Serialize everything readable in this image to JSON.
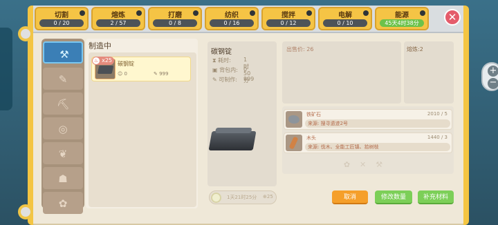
{
  "tabs": [
    {
      "label": "切割",
      "progress": "0 / 20"
    },
    {
      "label": "熔炼",
      "progress": "2 / 57"
    },
    {
      "label": "打磨",
      "progress": "0 / 8"
    },
    {
      "label": "纺织",
      "progress": "0 / 16"
    },
    {
      "label": "搅拌",
      "progress": "0 / 12"
    },
    {
      "label": "电解",
      "progress": "0 / 10"
    },
    {
      "label": "能源",
      "progress": "45天4时38分"
    }
  ],
  "close_symbol": "✕",
  "list": {
    "title": "制造中",
    "item": {
      "name": "碳钢锭",
      "badge": "x25",
      "meta_left": "0",
      "meta_right": "999"
    }
  },
  "detail": {
    "title": "碳钢锭",
    "rows": [
      {
        "label": "耗时:",
        "value": "1时50分"
      },
      {
        "label": "背包内:",
        "value": "0"
      },
      {
        "label": "可制作:",
        "value": "999"
      }
    ]
  },
  "sell": {
    "text": "出售价: 26"
  },
  "melt": {
    "text": "熔炼:2"
  },
  "materials": [
    {
      "name": "铁矿石",
      "count": "2010 / 5",
      "source": "来源: 搜寻遗迹2号",
      "icon": "rock-icon"
    },
    {
      "name": "木头",
      "count": "1440 / 3",
      "source": "来源: 伐木、全能工匠镇、拾树枝",
      "icon": "wood-icon"
    }
  ],
  "time": {
    "text": "1天21时25分",
    "queue": "25"
  },
  "buttons": {
    "cancel": "取消",
    "modify": "修改数量",
    "refill": "补充材料"
  },
  "colors": {
    "accent": "#f5c445",
    "energy": "#6cc24a",
    "cancel": "#f59f2a",
    "confirm": "#7ccf58"
  }
}
